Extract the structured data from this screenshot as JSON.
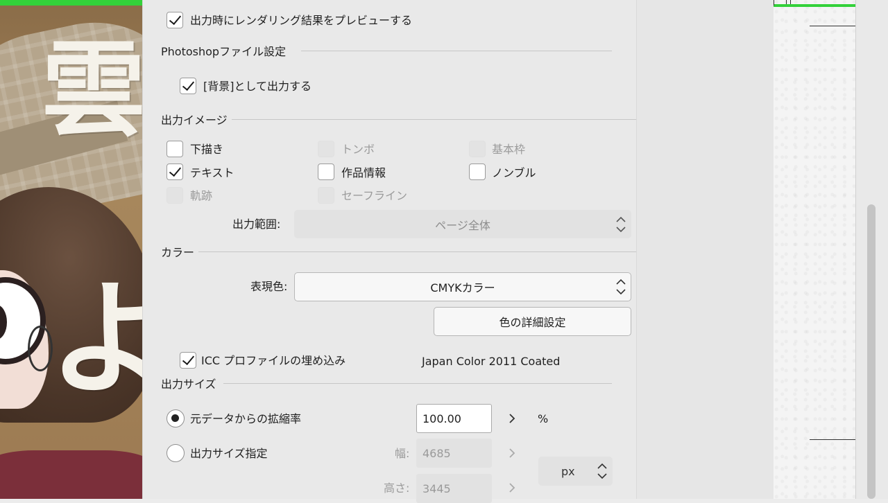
{
  "preview": {
    "label": "出力時にレンダリング結果をプレビューする",
    "checked": true
  },
  "photoshop": {
    "section_title": "Photoshopファイル設定",
    "background_label": "[背景]として出力する",
    "background_checked": true
  },
  "output_image": {
    "section_title": "出力イメージ",
    "items": [
      {
        "label": "下描き",
        "checked": false,
        "enabled": true
      },
      {
        "label": "トンボ",
        "checked": false,
        "enabled": false
      },
      {
        "label": "基本枠",
        "checked": false,
        "enabled": false
      },
      {
        "label": "テキスト",
        "checked": true,
        "enabled": true
      },
      {
        "label": "作品情報",
        "checked": false,
        "enabled": true
      },
      {
        "label": "ノンブル",
        "checked": false,
        "enabled": true
      },
      {
        "label": "軌跡",
        "checked": false,
        "enabled": false
      },
      {
        "label": "セーフライン",
        "checked": false,
        "enabled": false
      }
    ],
    "range_label": "出力範囲:",
    "range_value": "ページ全体"
  },
  "color": {
    "section_title": "カラー",
    "expression_label": "表現色:",
    "expression_value": "CMYKカラー",
    "detail_button": "色の詳細設定",
    "icc_label": "ICC プロファイルの埋め込み",
    "icc_checked": true,
    "icc_profile": "Japan Color 2011 Coated"
  },
  "output_size": {
    "section_title": "出力サイズ",
    "scale_label": "元データからの拡縮率",
    "scale_selected": true,
    "scale_value": "100.00",
    "scale_unit": "%",
    "size_label": "出力サイズ指定",
    "size_selected": false,
    "width_label": "幅:",
    "width_value": "4685",
    "height_label": "高さ:",
    "height_value": "3445",
    "size_unit": "px"
  },
  "artwork": {
    "glyph_top": "雲",
    "glyph_bottom": "よ"
  },
  "colors": {
    "accent_green": "#33d13a",
    "panel_bg": "#e9e9e9"
  }
}
